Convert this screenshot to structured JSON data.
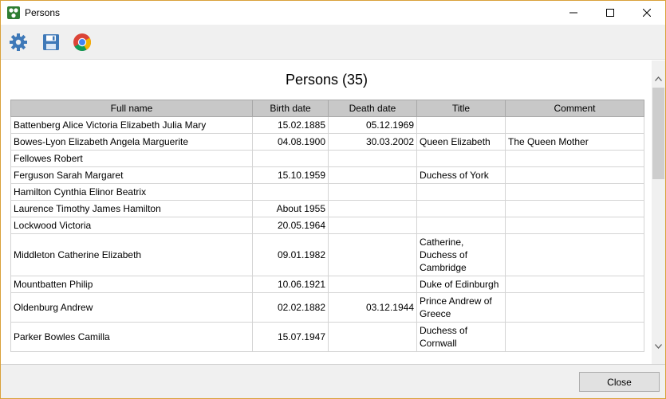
{
  "window": {
    "title": "Persons",
    "icon": "persons-app-icon",
    "accent": "#d9a13a"
  },
  "toolbar": {
    "settings_icon": "gear-icon",
    "save_icon": "save-icon",
    "chrome_icon": "chrome-icon"
  },
  "report": {
    "title": "Persons (35)"
  },
  "table": {
    "headers": [
      "Full name",
      "Birth date",
      "Death date",
      "Title",
      "Comment"
    ],
    "rows": [
      {
        "name": "Battenberg Alice Victoria Elizabeth Julia Mary",
        "birth": "15.02.1885",
        "death": "05.12.1969",
        "title": "",
        "comment": ""
      },
      {
        "name": "Bowes-Lyon Elizabeth Angela Marguerite",
        "birth": "04.08.1900",
        "death": "30.03.2002",
        "title": "Queen Elizabeth",
        "comment": "The Queen Mother"
      },
      {
        "name": "Fellowes Robert",
        "birth": "",
        "death": "",
        "title": "",
        "comment": ""
      },
      {
        "name": "Ferguson Sarah Margaret",
        "birth": "15.10.1959",
        "death": "",
        "title": "Duchess of York",
        "comment": ""
      },
      {
        "name": "Hamilton Cynthia Elinor Beatrix",
        "birth": "",
        "death": "",
        "title": "",
        "comment": ""
      },
      {
        "name": "Laurence Timothy James Hamilton",
        "birth": "About 1955",
        "death": "",
        "title": "",
        "comment": ""
      },
      {
        "name": "Lockwood Victoria",
        "birth": "20.05.1964",
        "death": "",
        "title": "",
        "comment": ""
      },
      {
        "name": "Middleton Catherine Elizabeth",
        "birth": "09.01.1982",
        "death": "",
        "title": "Catherine, Duchess of Cambridge",
        "comment": ""
      },
      {
        "name": "Mountbatten Philip",
        "birth": "10.06.1921",
        "death": "",
        "title": "Duke of Edinburgh",
        "comment": ""
      },
      {
        "name": "Oldenburg Andrew",
        "birth": "02.02.1882",
        "death": "03.12.1944",
        "title": "Prince Andrew of Greece",
        "comment": ""
      },
      {
        "name": "Parker Bowles Camilla",
        "birth": "15.07.1947",
        "death": "",
        "title": "Duchess of Cornwall",
        "comment": ""
      }
    ]
  },
  "footer": {
    "close_label": "Close"
  }
}
